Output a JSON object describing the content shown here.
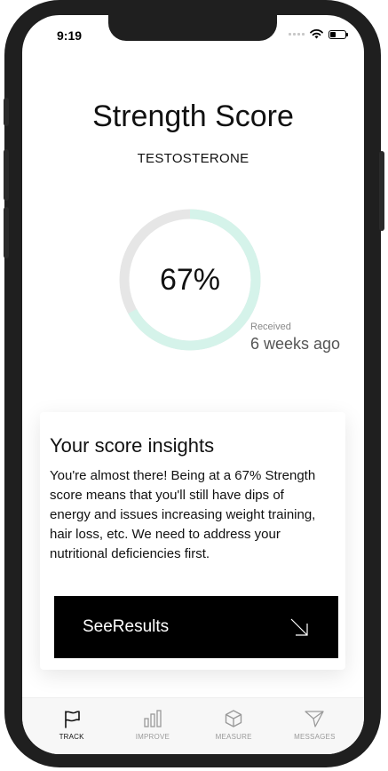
{
  "status_bar": {
    "time": "9:19"
  },
  "header": {
    "title": "Strength Score",
    "subtitle": "TESTOSTERONE"
  },
  "score": {
    "value_label": "67%",
    "percent": 67,
    "track_color": "#e6e6e6",
    "progress_color": "#d5f3ea",
    "received_label": "Received",
    "received_value": "6 weeks ago"
  },
  "insights": {
    "title": "Your score insights",
    "body": "You're almost there! Being at a 67% Strength score means that you'll still have dips of energy and issues increasing weight training, hair loss, etc. We need to address your nutritional deficiencies first.",
    "button_label": "SeeResults"
  },
  "tabs": [
    {
      "label": "TRACK",
      "icon": "flag-icon",
      "active": true
    },
    {
      "label": "IMPROVE",
      "icon": "bar-chart-icon",
      "active": false
    },
    {
      "label": "MEASURE",
      "icon": "cube-icon",
      "active": false
    },
    {
      "label": "MESSAGES",
      "icon": "send-icon",
      "active": false
    }
  ]
}
